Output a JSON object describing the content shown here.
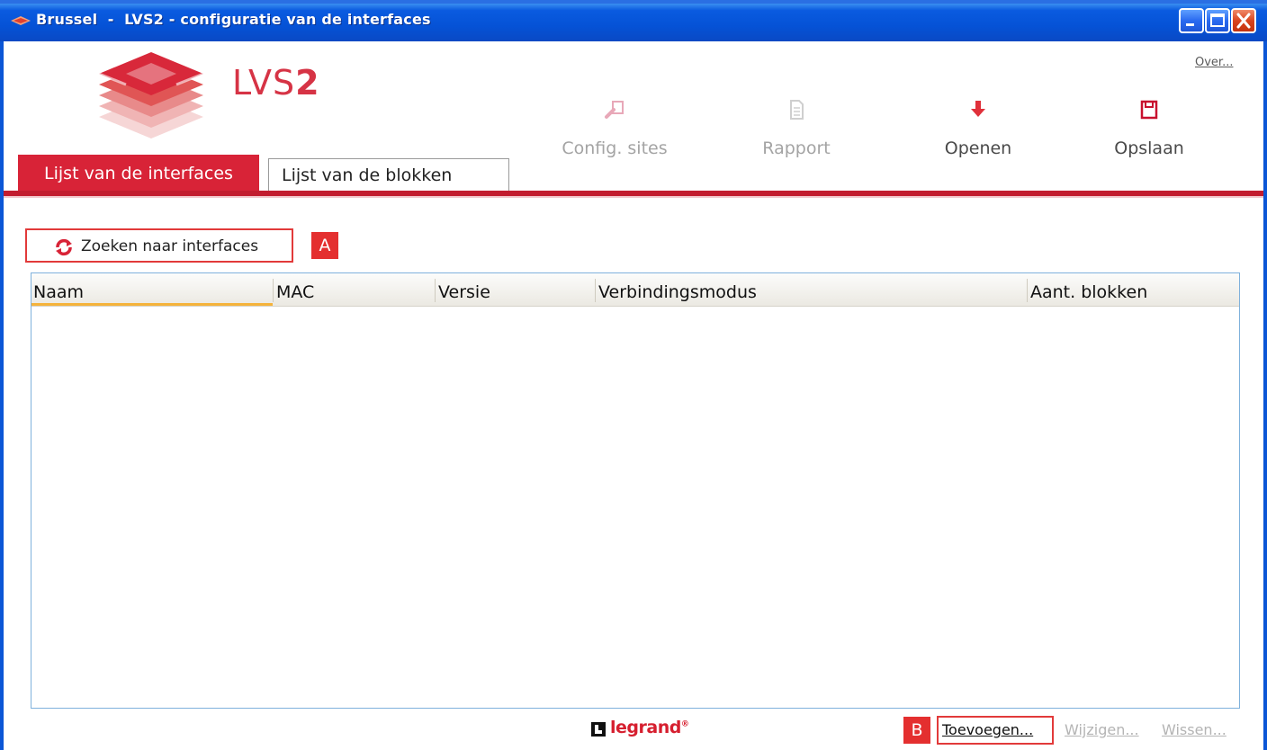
{
  "window": {
    "title": "Brussel  -  LVS2 - configuratie van de interfaces",
    "controls": [
      "minimize-icon",
      "maximize-icon",
      "close-icon"
    ]
  },
  "header": {
    "product_name": "LVS",
    "product_number": "2",
    "about_link": "Over...",
    "toolbar": [
      {
        "label": "Config. sites",
        "icon": "config-sites-icon",
        "enabled": false
      },
      {
        "label": "Rapport",
        "icon": "report-document-icon",
        "enabled": false
      },
      {
        "label": "Openen",
        "icon": "open-arrow-down-icon",
        "enabled": true
      },
      {
        "label": "Opslaan",
        "icon": "save-floppy-icon",
        "enabled": true
      }
    ]
  },
  "tabs": [
    {
      "label": "Lijst van de interfaces",
      "active": true
    },
    {
      "label": "Lijst van de blokken",
      "active": false
    }
  ],
  "main": {
    "search_button": "Zoeken naar interfaces",
    "marker_a": "A",
    "table": {
      "columns": [
        "Naam",
        "MAC",
        "Versie",
        "Verbindingsmodus",
        "Aant. blokken"
      ],
      "sorted_column": "Naam",
      "rows": []
    }
  },
  "footer": {
    "brand": "legrand",
    "brand_mark": "®",
    "marker_b": "B",
    "actions": [
      {
        "label": "Toevoegen...",
        "enabled": true
      },
      {
        "label": "Wijzigen...",
        "enabled": false
      },
      {
        "label": "Wissen...",
        "enabled": false
      }
    ]
  },
  "colors": {
    "accent_red": "#d82337",
    "titlebar_blue": "#0552d6",
    "disabled_text": "#a4a4a4",
    "sort_indicator": "#f5b33b"
  }
}
